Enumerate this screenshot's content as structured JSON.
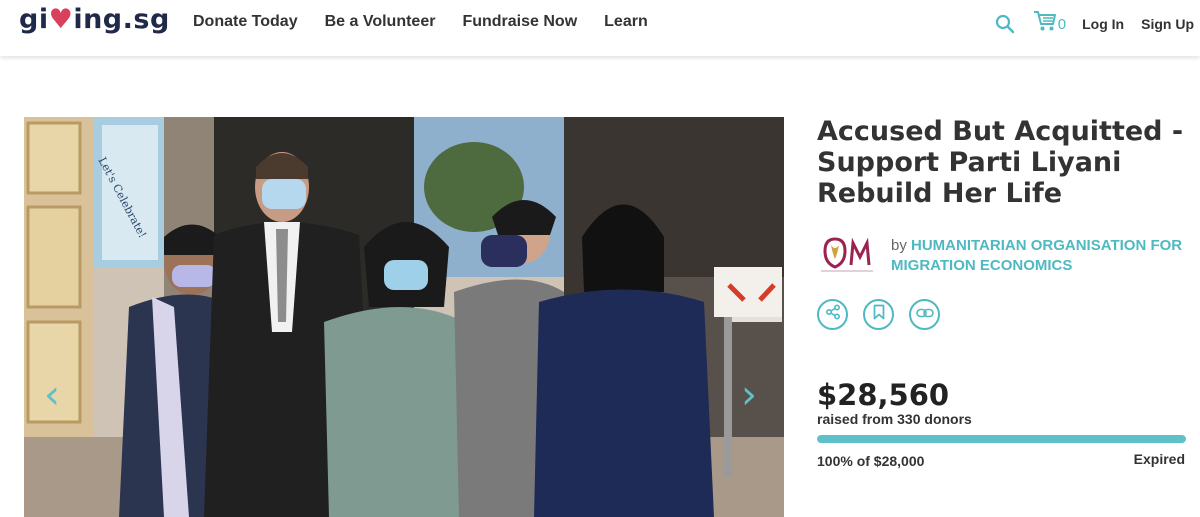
{
  "header": {
    "logo_text_before": "gi",
    "logo_heart": "♥",
    "logo_text_after": "ing.sg",
    "nav": [
      "Donate Today",
      "Be a Volunteer",
      "Fundraise Now",
      "Learn"
    ],
    "cart_count": "0",
    "login": "Log In",
    "signup": "Sign Up",
    "icons": {
      "search": "search-icon",
      "cart": "cart-icon"
    }
  },
  "hero": {
    "photo_sign_text": "Let's Celebrate!",
    "prev_glyph": "‹",
    "next_glyph": "›"
  },
  "campaign": {
    "title": "Accused But Acquitted - Support Parti Liyani Rebuild Her Life",
    "by_label": "by",
    "organiser": "HUMANITARIAN ORGANISATION FOR MIGRATION ECONOMICS",
    "actions": [
      "share-icon",
      "bookmark-icon",
      "link-icon"
    ],
    "amount_raised": "$28,560",
    "raised_text": "raised from 330 donors",
    "progress_fraction": 1.0,
    "progress_text": "100% of $28,000",
    "status": "Expired"
  },
  "colors": {
    "accent": "#4fb9c2",
    "heart": "#d8405c",
    "navy": "#1f2a4a",
    "text": "#333333"
  }
}
